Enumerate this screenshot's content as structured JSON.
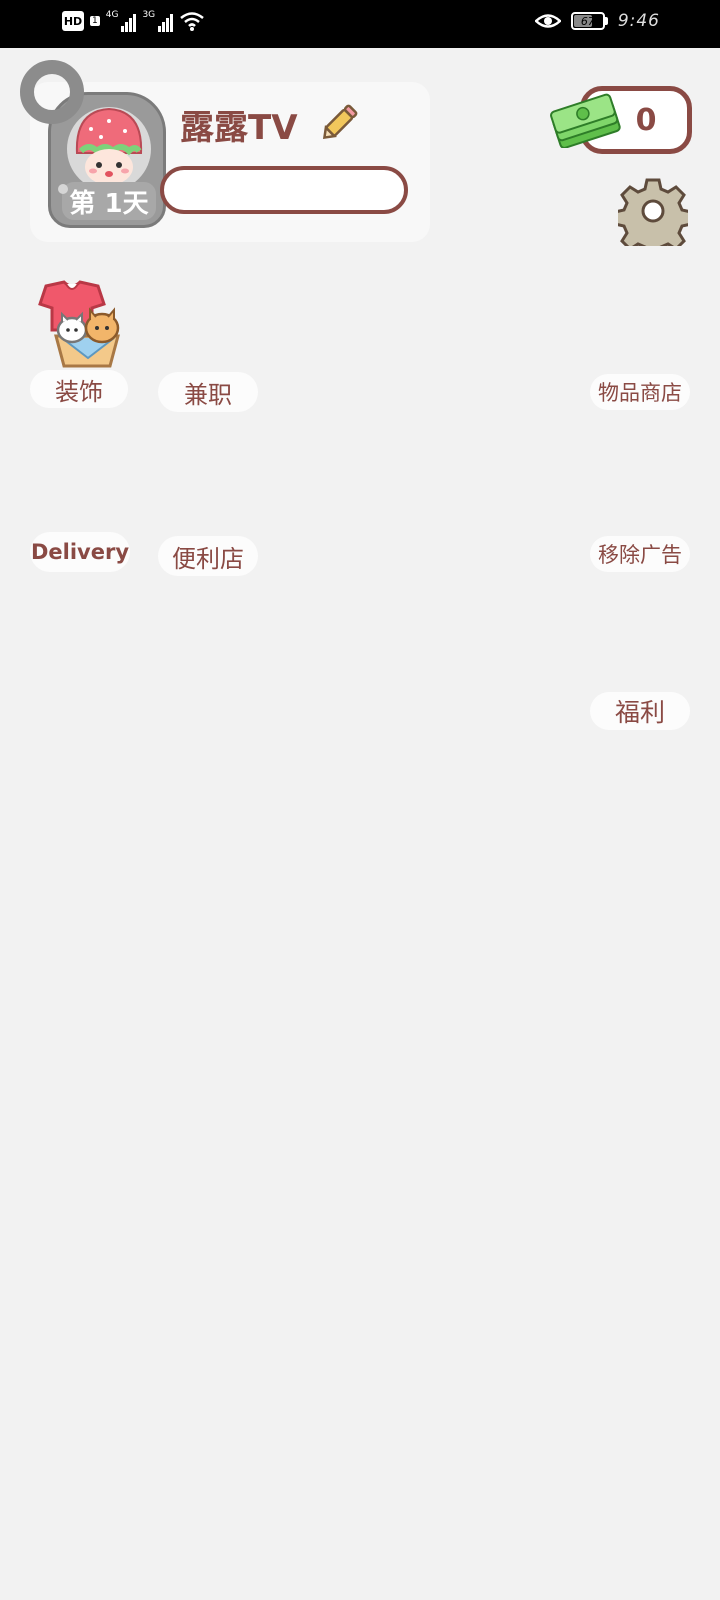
{
  "status_bar": {
    "hd_label": "HD",
    "sim_slot": "1",
    "network_1": "4G",
    "network_2": "3G",
    "battery_level": "67",
    "time": "9:46"
  },
  "profile": {
    "username": "露露TV",
    "day_label": "第 1天",
    "avatar_icon": "strawberry-girl-avatar"
  },
  "money": {
    "amount": "0",
    "icon": "cash-stack-icon"
  },
  "buttons": {
    "decoration": "装饰",
    "part_time": "兼职",
    "item_shop": "物品商店",
    "delivery": "Delivery",
    "convenience_store": "便利店",
    "remove_ads": "移除广告",
    "welfare": "福利"
  },
  "colors": {
    "accent": "#8a4a44",
    "background": "#f2f2f2",
    "card": "#f8f8f8"
  }
}
